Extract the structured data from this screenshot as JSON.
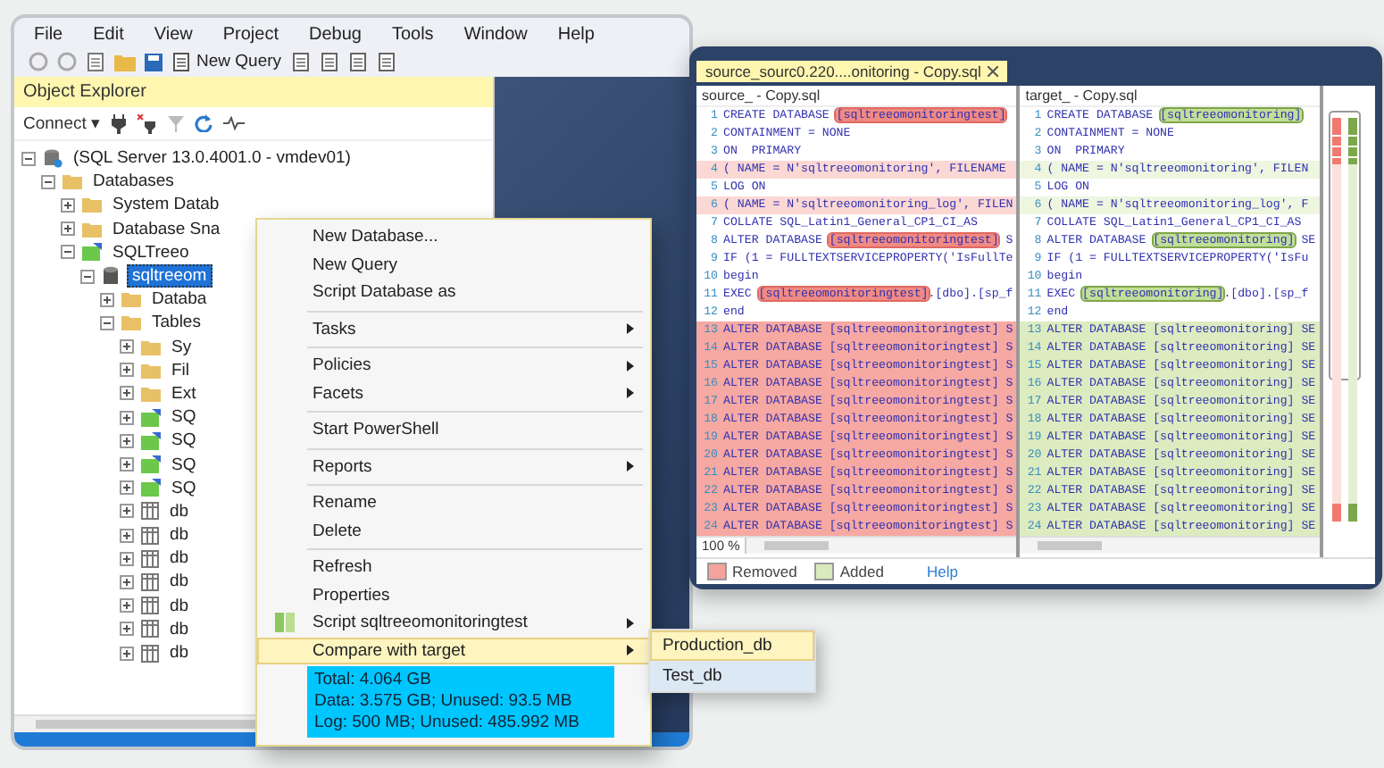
{
  "ssms": {
    "menu": [
      "File",
      "Edit",
      "View",
      "Project",
      "Debug",
      "Tools",
      "Window",
      "Help"
    ],
    "toolbar": {
      "new_query": "New Query"
    },
    "object_explorer": {
      "title": "Object Explorer",
      "connect": "Connect ▾",
      "tree": [
        {
          "label": "(SQL Server 13.0.4001.0 - vmdev01)",
          "kind": "server",
          "expanded": true,
          "selected": false,
          "children": [
            {
              "label": "Databases",
              "kind": "folder",
              "expanded": true,
              "selected": false,
              "children": [
                {
                  "label": "System Datab",
                  "kind": "folder",
                  "expanded": false,
                  "selected": false
                },
                {
                  "label": "Database Sna",
                  "kind": "folder",
                  "expanded": false,
                  "selected": false
                },
                {
                  "label": "SQLTreeo",
                  "kind": "sqlobject",
                  "expanded": true,
                  "selected": false,
                  "children": [
                    {
                      "label": "sqltreeom",
                      "kind": "database",
                      "expanded": true,
                      "selected": true,
                      "children": [
                        {
                          "label": "Databa",
                          "kind": "folder",
                          "expanded": false,
                          "selected": false
                        },
                        {
                          "label": "Tables",
                          "kind": "folder",
                          "expanded": true,
                          "selected": false,
                          "children": [
                            {
                              "label": "Sy",
                              "kind": "folder",
                              "expanded": false,
                              "selected": false
                            },
                            {
                              "label": "Fil",
                              "kind": "folder",
                              "expanded": false,
                              "selected": false
                            },
                            {
                              "label": "Ext",
                              "kind": "folder",
                              "expanded": false,
                              "selected": false
                            },
                            {
                              "label": "SQ",
                              "kind": "sqlobject",
                              "expanded": false,
                              "selected": false
                            },
                            {
                              "label": "SQ",
                              "kind": "sqlobject",
                              "expanded": false,
                              "selected": false
                            },
                            {
                              "label": "SQ",
                              "kind": "sqlobject",
                              "expanded": false,
                              "selected": false
                            },
                            {
                              "label": "SQ",
                              "kind": "sqlobject",
                              "expanded": false,
                              "selected": false
                            },
                            {
                              "label": "db",
                              "kind": "table",
                              "expanded": false,
                              "selected": false
                            },
                            {
                              "label": "db",
                              "kind": "table",
                              "expanded": false,
                              "selected": false
                            },
                            {
                              "label": "db",
                              "kind": "table",
                              "expanded": false,
                              "selected": false
                            },
                            {
                              "label": "db",
                              "kind": "table",
                              "expanded": false,
                              "selected": false
                            },
                            {
                              "label": "db",
                              "kind": "table",
                              "expanded": false,
                              "selected": false
                            },
                            {
                              "label": "db",
                              "kind": "table",
                              "expanded": false,
                              "selected": false
                            },
                            {
                              "label": "db",
                              "kind": "table",
                              "expanded": false,
                              "selected": false
                            }
                          ]
                        }
                      ]
                    }
                  ]
                }
              ]
            }
          ]
        }
      ]
    },
    "context_menu": {
      "items": [
        {
          "kind": "item",
          "label": "New Database...",
          "submenu": false,
          "selected": false
        },
        {
          "kind": "item",
          "label": "New Query",
          "submenu": false,
          "selected": false
        },
        {
          "kind": "item",
          "label": "Script Database as",
          "submenu": false,
          "selected": false
        },
        {
          "kind": "separator"
        },
        {
          "kind": "item",
          "label": "Tasks",
          "submenu": true,
          "selected": false
        },
        {
          "kind": "separator"
        },
        {
          "kind": "item",
          "label": "Policies",
          "submenu": true,
          "selected": false
        },
        {
          "kind": "item",
          "label": "Facets",
          "submenu": true,
          "selected": false
        },
        {
          "kind": "separator"
        },
        {
          "kind": "item",
          "label": "Start PowerShell",
          "submenu": false,
          "selected": false
        },
        {
          "kind": "separator"
        },
        {
          "kind": "item",
          "label": "Reports",
          "submenu": true,
          "selected": false
        },
        {
          "kind": "separator"
        },
        {
          "kind": "item",
          "label": "Rename",
          "submenu": false,
          "selected": false
        },
        {
          "kind": "item",
          "label": "Delete",
          "submenu": false,
          "selected": false
        },
        {
          "kind": "separator"
        },
        {
          "kind": "item",
          "label": "Refresh",
          "submenu": false,
          "selected": false
        },
        {
          "kind": "item",
          "label": "Properties",
          "submenu": false,
          "selected": false
        },
        {
          "kind": "icon_item",
          "label": "Script sqltreeomonitoringtest",
          "submenu": true,
          "selected": false
        },
        {
          "kind": "item",
          "label": "Compare with target",
          "submenu": true,
          "selected": true
        }
      ],
      "info": [
        "Total: 4.064 GB",
        "Data: 3.575 GB; Unused: 93.5 MB",
        "Log: 500 MB; Unused: 485.992 MB"
      ]
    },
    "submenu": [
      {
        "label": "Production_db",
        "selected": true
      },
      {
        "label": "Test_db",
        "selected": false
      }
    ]
  },
  "compare": {
    "tab": "source_sourc0.220....onitoring - Copy.sql",
    "source": {
      "title": "source_ - Copy.sql",
      "lines": [
        {
          "n": "1",
          "kind": "token",
          "text": "CREATE DATABASE **[sqltreeomonitoringtest]**"
        },
        {
          "n": "2",
          "kind": "plain",
          "text": "CONTAINMENT = NONE"
        },
        {
          "n": "3",
          "kind": "plain",
          "text": "ON  PRIMARY"
        },
        {
          "n": "4",
          "kind": "light",
          "text": "( NAME = N'sqltreeomonitoring', FILENAME"
        },
        {
          "n": "5",
          "kind": "plain",
          "text": "LOG ON"
        },
        {
          "n": "6",
          "kind": "light",
          "text": "( NAME = N'sqltreeomonitoring_log', FILEN"
        },
        {
          "n": "7",
          "kind": "plain",
          "text": "COLLATE SQL_Latin1_General_CP1_CI_AS"
        },
        {
          "n": "8",
          "kind": "token",
          "text": "ALTER DATABASE **[sqltreeomonitoringtest]** S"
        },
        {
          "n": "9",
          "kind": "plain",
          "text": "IF (1 = FULLTEXTSERVICEPROPERTY('IsFullTe"
        },
        {
          "n": "10",
          "kind": "plain",
          "text": "begin"
        },
        {
          "n": "11",
          "kind": "token",
          "text": "EXEC **[sqltreeomonitoringtest]**.[dbo].[sp_f"
        },
        {
          "n": "12",
          "kind": "plain",
          "text": "end"
        },
        {
          "n": "13",
          "kind": "full",
          "text": "ALTER DATABASE [sqltreeomonitoringtest] S"
        },
        {
          "n": "14",
          "kind": "full",
          "text": "ALTER DATABASE [sqltreeomonitoringtest] S"
        },
        {
          "n": "15",
          "kind": "full",
          "text": "ALTER DATABASE [sqltreeomonitoringtest] S"
        },
        {
          "n": "16",
          "kind": "full",
          "text": "ALTER DATABASE [sqltreeomonitoringtest] S"
        },
        {
          "n": "17",
          "kind": "full",
          "text": "ALTER DATABASE [sqltreeomonitoringtest] S"
        },
        {
          "n": "18",
          "kind": "full",
          "text": "ALTER DATABASE [sqltreeomonitoringtest] S"
        },
        {
          "n": "19",
          "kind": "full",
          "text": "ALTER DATABASE [sqltreeomonitoringtest] S"
        },
        {
          "n": "20",
          "kind": "full",
          "text": "ALTER DATABASE [sqltreeomonitoringtest] S"
        },
        {
          "n": "21",
          "kind": "full",
          "text": "ALTER DATABASE [sqltreeomonitoringtest] S"
        },
        {
          "n": "22",
          "kind": "full",
          "text": "ALTER DATABASE [sqltreeomonitoringtest] S"
        },
        {
          "n": "23",
          "kind": "full",
          "text": "ALTER DATABASE [sqltreeomonitoringtest] S"
        },
        {
          "n": "24",
          "kind": "full",
          "text": "ALTER DATABASE [sqltreeomonitoringtest] S"
        }
      ]
    },
    "target": {
      "title": "target_ - Copy.sql",
      "lines": [
        {
          "n": "1",
          "kind": "token",
          "text": "CREATE DATABASE **[sqltreeomonitoring]**"
        },
        {
          "n": "2",
          "kind": "plain",
          "text": "CONTAINMENT = NONE"
        },
        {
          "n": "3",
          "kind": "plain",
          "text": "ON  PRIMARY"
        },
        {
          "n": "4",
          "kind": "light",
          "text": "( NAME = N'sqltreeomonitoring', FILEN"
        },
        {
          "n": "5",
          "kind": "plain",
          "text": "LOG ON"
        },
        {
          "n": "6",
          "kind": "light",
          "text": "( NAME = N'sqltreeomonitoring_log', F"
        },
        {
          "n": "7",
          "kind": "plain",
          "text": "COLLATE SQL_Latin1_General_CP1_CI_AS"
        },
        {
          "n": "8",
          "kind": "token",
          "text": "ALTER DATABASE **[sqltreeomonitoring]** SE"
        },
        {
          "n": "9",
          "kind": "plain",
          "text": "IF (1 = FULLTEXTSERVICEPROPERTY('IsFu"
        },
        {
          "n": "10",
          "kind": "plain",
          "text": "begin"
        },
        {
          "n": "11",
          "kind": "token",
          "text": "EXEC **[sqltreeomonitoring]**.[dbo].[sp_f"
        },
        {
          "n": "12",
          "kind": "plain",
          "text": "end"
        },
        {
          "n": "13",
          "kind": "full",
          "text": "ALTER DATABASE [sqltreeomonitoring] SE"
        },
        {
          "n": "14",
          "kind": "full",
          "text": "ALTER DATABASE [sqltreeomonitoring] SE"
        },
        {
          "n": "15",
          "kind": "full",
          "text": "ALTER DATABASE [sqltreeomonitoring] SE"
        },
        {
          "n": "16",
          "kind": "full",
          "text": "ALTER DATABASE [sqltreeomonitoring] SE"
        },
        {
          "n": "17",
          "kind": "full",
          "text": "ALTER DATABASE [sqltreeomonitoring] SE"
        },
        {
          "n": "18",
          "kind": "full",
          "text": "ALTER DATABASE [sqltreeomonitoring] SE"
        },
        {
          "n": "19",
          "kind": "full",
          "text": "ALTER DATABASE [sqltreeomonitoring] SE"
        },
        {
          "n": "20",
          "kind": "full",
          "text": "ALTER DATABASE [sqltreeomonitoring] SE"
        },
        {
          "n": "21",
          "kind": "full",
          "text": "ALTER DATABASE [sqltreeomonitoring] SE"
        },
        {
          "n": "22",
          "kind": "full",
          "text": "ALTER DATABASE [sqltreeomonitoring] SE"
        },
        {
          "n": "23",
          "kind": "full",
          "text": "ALTER DATABASE [sqltreeomonitoring] SE"
        },
        {
          "n": "24",
          "kind": "full",
          "text": "ALTER DATABASE [sqltreeomonitoring] SE"
        }
      ]
    },
    "zoom": "100 %",
    "legend": [
      {
        "label": "Removed",
        "color": "#f4a29c"
      },
      {
        "label": "Added",
        "color": "#d9eabc"
      }
    ],
    "help": "Help"
  }
}
